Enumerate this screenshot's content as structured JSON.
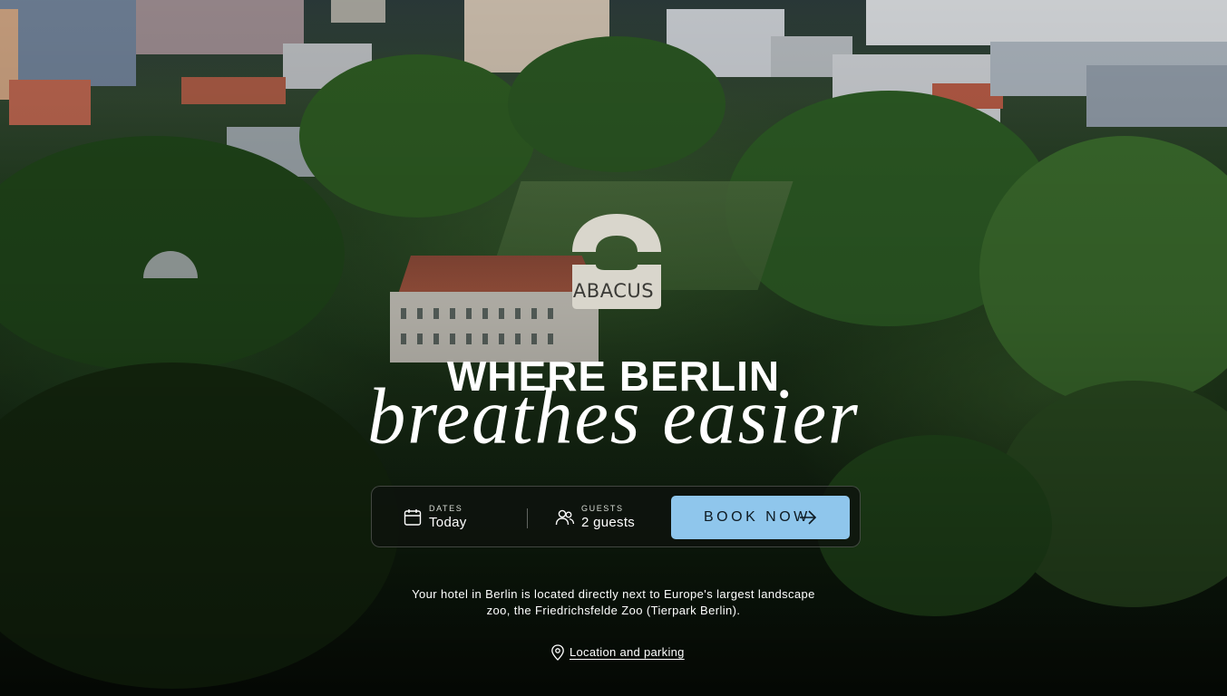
{
  "brand": {
    "logo_text": "ABACUS",
    "logo_color": "#d9d6cc"
  },
  "hero": {
    "headline": "WHERE BERLIN",
    "subline": "breathes easier",
    "background_description_colors": {
      "tree_green": "#2f5a26",
      "sky": "#2b3a3a"
    }
  },
  "booking": {
    "dates": {
      "label": "DATES",
      "value": "Today",
      "icon": "calendar-icon"
    },
    "guests": {
      "label": "GUESTS",
      "value": "2 guests",
      "icon": "guests-icon"
    },
    "book_button": {
      "label": "BOOK NOW",
      "icon": "arrow-right-icon",
      "color": "#8fc6ec"
    }
  },
  "description": {
    "line1": "Your hotel in Berlin is located directly next to Europe's largest landscape",
    "line2": "zoo, the Friedrichsfelde Zoo (Tierpark Berlin)."
  },
  "location_link": {
    "label": "Location and parking",
    "icon": "location-pin-icon"
  }
}
